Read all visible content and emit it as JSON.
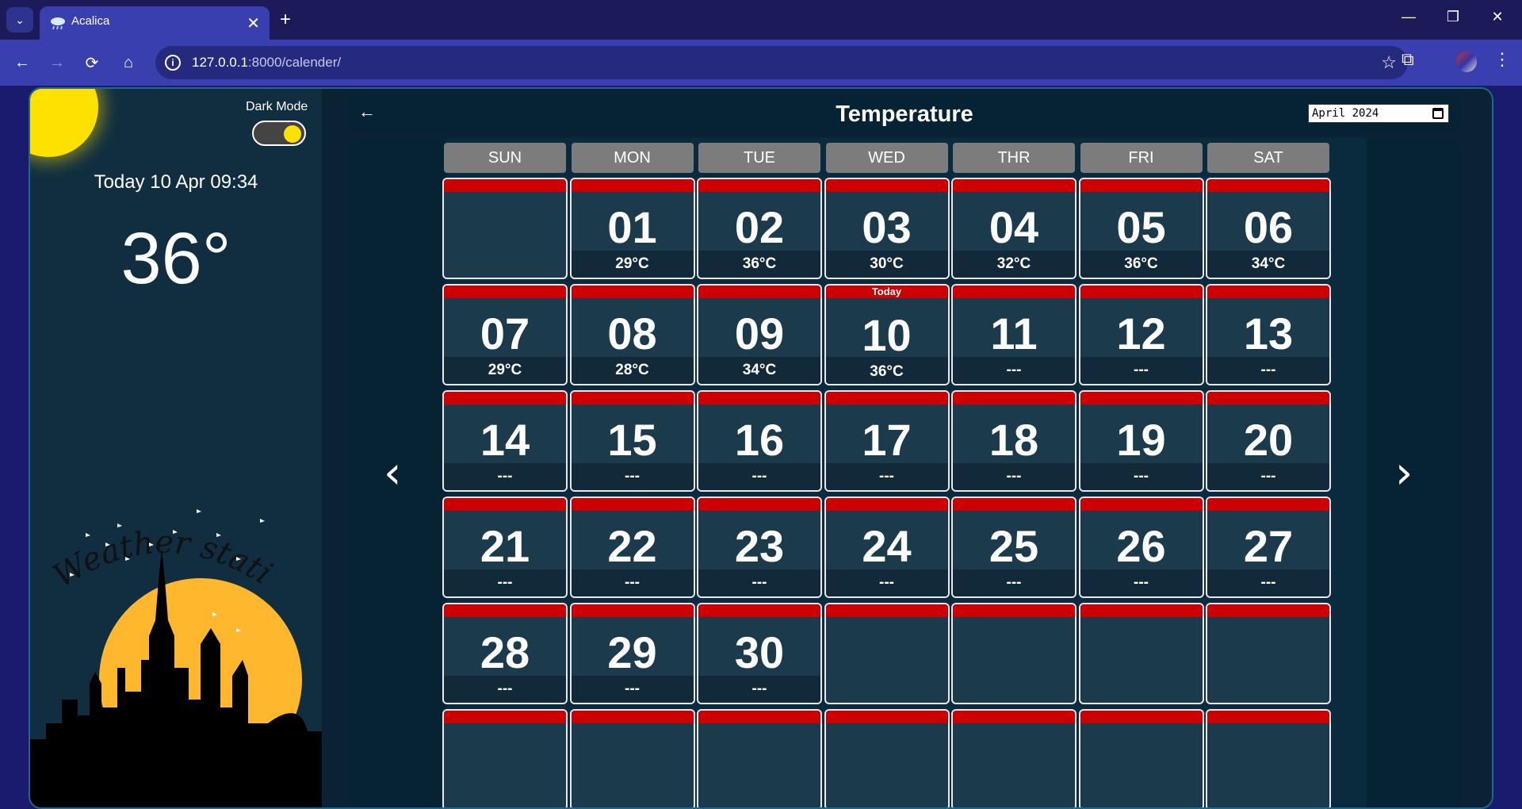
{
  "browser": {
    "tab_title": "Acalica",
    "url_host": "127.0.0.1",
    "url_rest": ":8000/calender/"
  },
  "sidebar": {
    "dark_mode_label": "Dark Mode",
    "dark_mode_on": true,
    "today_text": "Today 10 Apr 09:34",
    "current_temp": "36°",
    "logo_text": "Weather station"
  },
  "calendar": {
    "title": "Temperature",
    "month_value": "April 2024",
    "weekdays": [
      "SUN",
      "MON",
      "TUE",
      "WED",
      "THR",
      "FRI",
      "SAT"
    ],
    "today_badge": "Today",
    "cells": [
      {
        "day": "",
        "temp": ""
      },
      {
        "day": "01",
        "temp": "29°C"
      },
      {
        "day": "02",
        "temp": "36°C"
      },
      {
        "day": "03",
        "temp": "30°C"
      },
      {
        "day": "04",
        "temp": "32°C"
      },
      {
        "day": "05",
        "temp": "36°C"
      },
      {
        "day": "06",
        "temp": "34°C"
      },
      {
        "day": "07",
        "temp": "29°C"
      },
      {
        "day": "08",
        "temp": "28°C"
      },
      {
        "day": "09",
        "temp": "34°C"
      },
      {
        "day": "10",
        "temp": "36°C",
        "today": true
      },
      {
        "day": "11",
        "temp": "---"
      },
      {
        "day": "12",
        "temp": "---"
      },
      {
        "day": "13",
        "temp": "---"
      },
      {
        "day": "14",
        "temp": "---"
      },
      {
        "day": "15",
        "temp": "---"
      },
      {
        "day": "16",
        "temp": "---"
      },
      {
        "day": "17",
        "temp": "---"
      },
      {
        "day": "18",
        "temp": "---"
      },
      {
        "day": "19",
        "temp": "---"
      },
      {
        "day": "20",
        "temp": "---"
      },
      {
        "day": "21",
        "temp": "---"
      },
      {
        "day": "22",
        "temp": "---"
      },
      {
        "day": "23",
        "temp": "---"
      },
      {
        "day": "24",
        "temp": "---"
      },
      {
        "day": "25",
        "temp": "---"
      },
      {
        "day": "26",
        "temp": "---"
      },
      {
        "day": "27",
        "temp": "---"
      },
      {
        "day": "28",
        "temp": "---"
      },
      {
        "day": "29",
        "temp": "---"
      },
      {
        "day": "30",
        "temp": "---"
      },
      {
        "day": "",
        "temp": ""
      },
      {
        "day": "",
        "temp": ""
      },
      {
        "day": "",
        "temp": ""
      },
      {
        "day": "",
        "temp": ""
      },
      {
        "day": "",
        "temp": ""
      },
      {
        "day": "",
        "temp": ""
      },
      {
        "day": "",
        "temp": ""
      },
      {
        "day": "",
        "temp": ""
      },
      {
        "day": "",
        "temp": ""
      },
      {
        "day": "",
        "temp": ""
      },
      {
        "day": "",
        "temp": ""
      }
    ]
  },
  "colors": {
    "accent_red": "#cc0000",
    "sun_yellow": "#ffe100",
    "page_bg": "#0c2a3c"
  }
}
